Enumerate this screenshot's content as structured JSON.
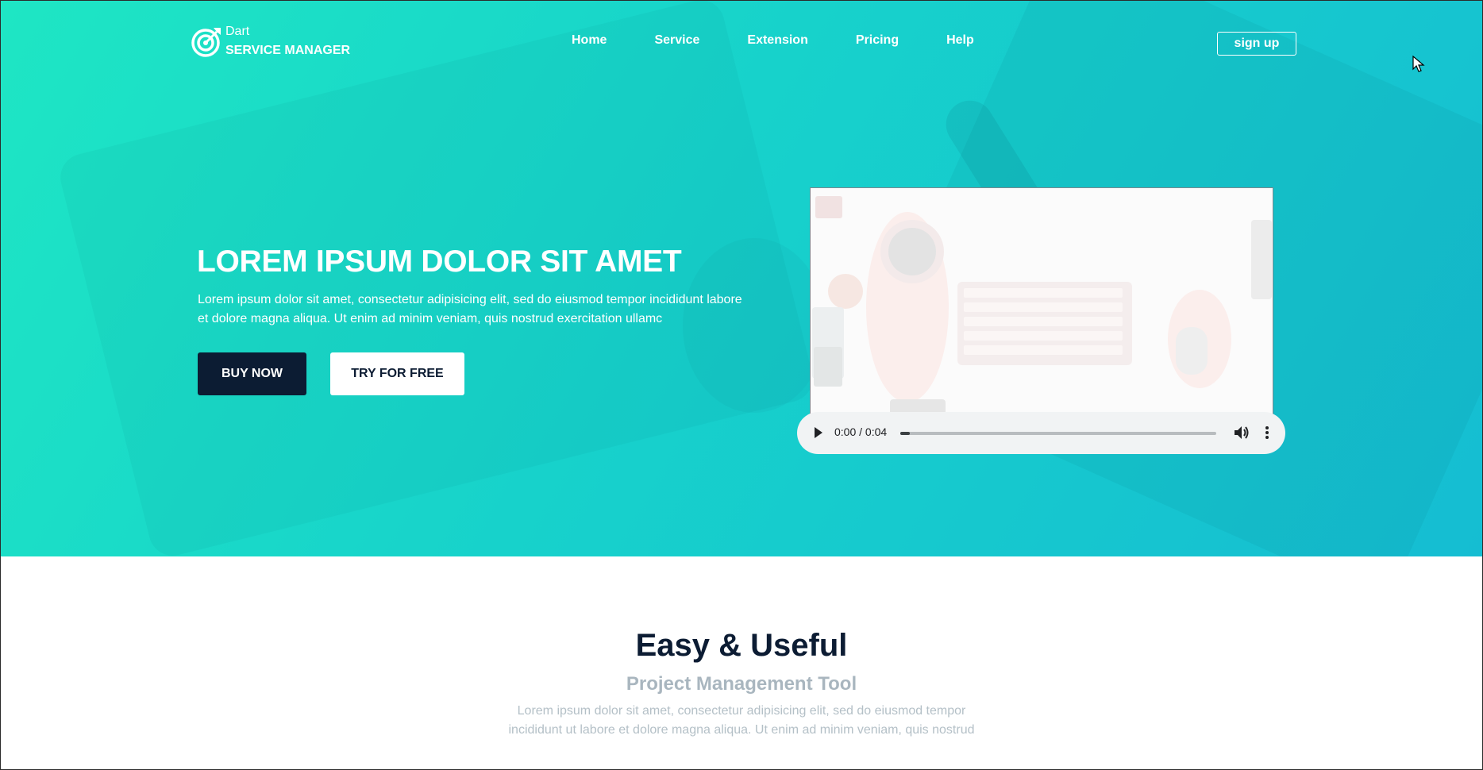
{
  "brand": {
    "line1": "Dart",
    "line2": "SERVICE MANAGER"
  },
  "nav": {
    "items": [
      {
        "label": "Home"
      },
      {
        "label": "Service"
      },
      {
        "label": "Extension"
      },
      {
        "label": "Pricing"
      },
      {
        "label": "Help"
      }
    ],
    "signup_label": "sign up"
  },
  "hero": {
    "title": "LOREM IPSUM DOLOR SIT AMET",
    "description": "Lorem ipsum dolor sit amet, consectetur adipisicing elit, sed do eiusmod tempor incididunt labore et dolore magna aliqua. Ut enim ad minim veniam, quis nostrud exercitation ullamc",
    "buy_label": "BUY NOW",
    "try_label": "TRY FOR FREE"
  },
  "media_player": {
    "time": "0:00 / 0:04",
    "progress_fraction": 0.03,
    "play_icon": "play-icon",
    "volume_icon": "volume-icon",
    "more_icon": "more-vertical-icon"
  },
  "features": {
    "title": "Easy & Useful",
    "subtitle": "Project Management Tool",
    "description": "Lorem ipsum dolor sit amet, consectetur adipisicing elit, sed do eiusmod tempor incididunt ut labore et dolore magna aliqua. Ut enim ad minim veniam, quis nostrud"
  },
  "colors": {
    "hero_gradient_start": "#1ee6c4",
    "hero_gradient_end": "#15bdd2",
    "dark_navy": "#0c1c33",
    "muted_text": "#a9b6bf"
  }
}
